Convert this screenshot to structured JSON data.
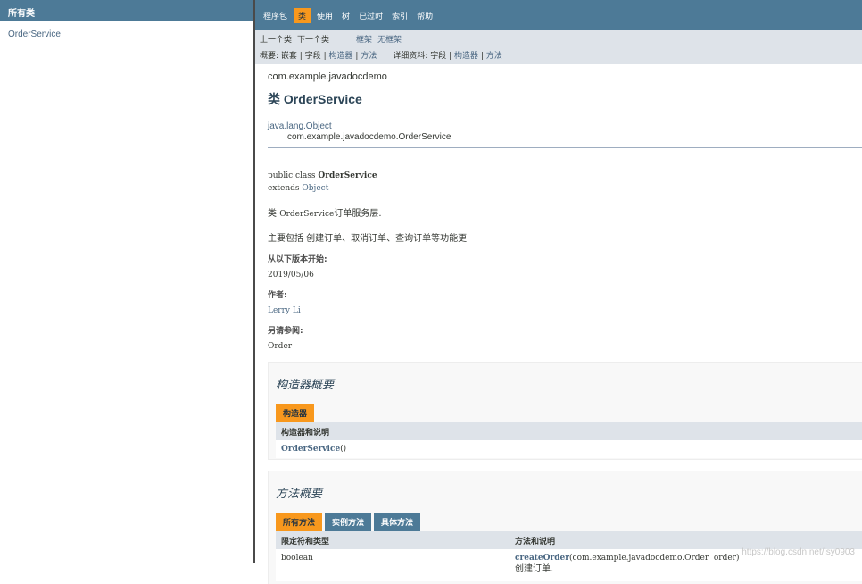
{
  "left": {
    "header": "所有类",
    "items": [
      "OrderService"
    ]
  },
  "topnav": {
    "items": [
      "程序包",
      "类",
      "使用",
      "树",
      "已过时",
      "索引",
      "帮助"
    ],
    "active": "类"
  },
  "subnav": {
    "prev_class": "上一个类",
    "next_class": "下一个类",
    "frames": "框架",
    "no_frames": "无框架",
    "summary_label": "概要:",
    "summary_nested": "嵌套",
    "summary_field": "字段",
    "summary_constr": "构造器",
    "summary_method": "方法",
    "detail_label": "详细资料:",
    "detail_field": "字段",
    "detail_constr": "构造器",
    "detail_method": "方法"
  },
  "class_doc": {
    "package": "com.example.javadocdemo",
    "title": "类 OrderService",
    "inherit_root": "java.lang.Object",
    "inherit_child": "com.example.javadocdemo.OrderService",
    "sig_prefix": "public class ",
    "sig_name": "OrderService",
    "sig_extends": "extends ",
    "sig_super": "Object",
    "desc_prefix": "类 ",
    "desc_code": "OrderService",
    "desc_suffix": "订单服务层.",
    "desc2": "主要包括 创建订单、取消订单、查询订单等功能更",
    "since_label": "从以下版本开始:",
    "since_value": "2019/05/06",
    "author_label": "作者:",
    "author_value": "Lerry Li",
    "see_label": "另请参阅:",
    "see_value": "Order"
  },
  "constructor_summary": {
    "title": "构造器概要",
    "tab": "构造器",
    "header": "构造器和说明",
    "rows": [
      {
        "name": "OrderService",
        "suffix": "()"
      }
    ]
  },
  "method_summary": {
    "title": "方法概要",
    "tabs": [
      "所有方法",
      "实例方法",
      "具体方法"
    ],
    "col1_header": "限定符和类型",
    "col2_header": "方法和说明",
    "rows": [
      {
        "type": "boolean",
        "name": "createOrder",
        "params": "(com.example.javadocdemo.Order  order)",
        "desc": "创建订单."
      }
    ]
  },
  "watermark": "https://blog.csdn.net/lsy0903",
  "colors": {
    "nav_bg": "#4d7a97",
    "active_tab": "#f8981d",
    "subnav_bg": "#dee3e9",
    "link": "#4a6782"
  }
}
